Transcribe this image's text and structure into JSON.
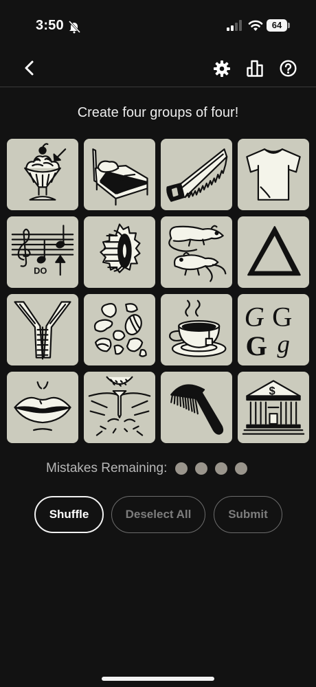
{
  "status_bar": {
    "time": "3:50",
    "battery": "64"
  },
  "nav": {
    "back": "back-chevron-icon",
    "settings": "gear-icon",
    "stats": "bar-chart-icon",
    "help": "question-circle-icon"
  },
  "instruction": "Create four groups of four!",
  "tiles": [
    {
      "icon": "sundae-icon"
    },
    {
      "icon": "bed-icon"
    },
    {
      "icon": "saw-icon"
    },
    {
      "icon": "t-shirt-icon"
    },
    {
      "icon": "music-staff-icon",
      "text": "DO"
    },
    {
      "icon": "gear-cog-icon"
    },
    {
      "icon": "rats-icon"
    },
    {
      "icon": "triangle-icon"
    },
    {
      "icon": "zipper-icon"
    },
    {
      "icon": "nuts-icon"
    },
    {
      "icon": "tea-cup-icon"
    },
    {
      "icon": "letter-g-icon",
      "glyphs": [
        "G",
        "G",
        "G",
        "g"
      ]
    },
    {
      "icon": "lips-icon"
    },
    {
      "icon": "golf-tee-icon"
    },
    {
      "icon": "comb-icon"
    },
    {
      "icon": "bank-icon",
      "text": "$"
    }
  ],
  "mistakes": {
    "label": "Mistakes Remaining:",
    "remaining": 4
  },
  "buttons": {
    "shuffle": "Shuffle",
    "deselect": "Deselect All",
    "submit": "Submit"
  },
  "colors": {
    "background": "#121212",
    "tile": "#cbcbbd",
    "dot": "#9a958c"
  }
}
